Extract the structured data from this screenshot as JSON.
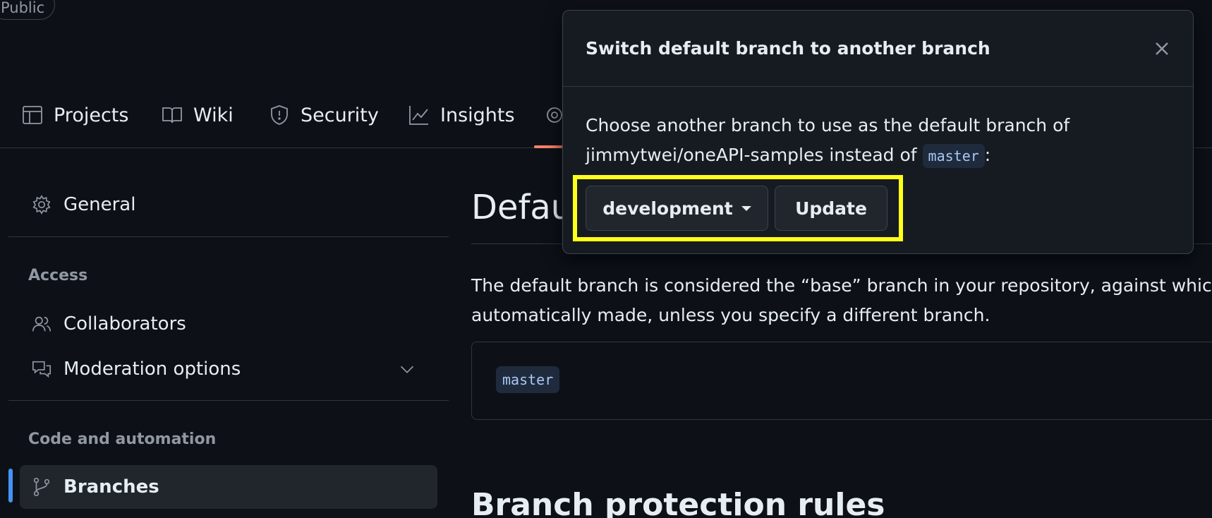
{
  "header": {
    "visibility_badge": "Public"
  },
  "nav": {
    "items": [
      {
        "label": "Projects",
        "icon": "table-icon"
      },
      {
        "label": "Wiki",
        "icon": "book-icon"
      },
      {
        "label": "Security",
        "icon": "shield-icon"
      },
      {
        "label": "Insights",
        "icon": "graph-icon"
      }
    ],
    "settings_icon": "gear-icon",
    "active_underline_color": "#f78166"
  },
  "sidebar": {
    "general": "General",
    "access_heading": "Access",
    "collaborators": "Collaborators",
    "moderation": "Moderation options",
    "code_heading": "Code and automation",
    "branches": "Branches",
    "active_color": "#4493f8"
  },
  "main": {
    "heading": "Default branch",
    "description_line1": "The default branch is considered the “base” branch in your repository, against which all pull requests and code commits are",
    "description_line2": "automatically made, unless you specify a different branch.",
    "current_branch": "master",
    "section_heading": "Branch protection rules"
  },
  "popup": {
    "title": "Switch default branch to another branch",
    "body_line1": "Choose another branch to use as the default branch of",
    "body_line2_prefix": "jimmytwei/oneAPI-samples instead of",
    "body_branch": "master",
    "body_suffix": ":",
    "branch_select": "development",
    "update_button": "Update",
    "highlight_color": "#ffff1a"
  }
}
